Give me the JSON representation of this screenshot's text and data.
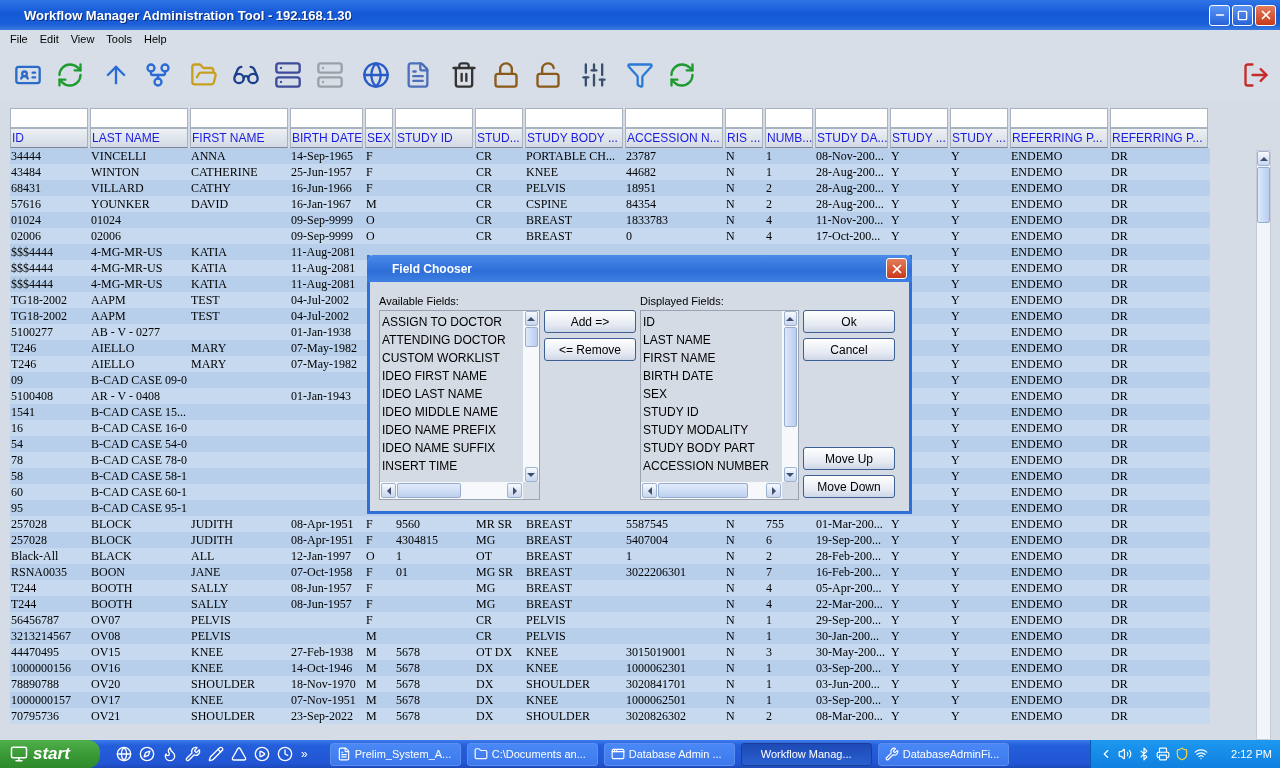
{
  "window": {
    "title": "Workflow Manager Administration Tool - 192.168.1.30"
  },
  "menu": [
    "File",
    "Edit",
    "View",
    "Tools",
    "Help"
  ],
  "toolbar": {
    "groups": [
      [
        {
          "kind": "id-card",
          "disabled": false
        },
        {
          "kind": "refresh",
          "disabled": false
        }
      ],
      [
        {
          "kind": "arrow-up",
          "disabled": false
        },
        {
          "kind": "fork",
          "disabled": false
        }
      ],
      [
        {
          "kind": "folder",
          "disabled": false
        },
        {
          "kind": "glasses",
          "disabled": false
        },
        {
          "kind": "server",
          "disabled": false
        },
        {
          "kind": "server",
          "disabled": true
        }
      ],
      [
        {
          "kind": "globe",
          "disabled": false
        },
        {
          "kind": "document",
          "disabled": false
        }
      ],
      [
        {
          "kind": "trash",
          "disabled": false
        },
        {
          "kind": "lock",
          "disabled": false
        },
        {
          "kind": "unlock",
          "disabled": false
        }
      ],
      [
        {
          "kind": "sliders",
          "disabled": false
        }
      ],
      [
        {
          "kind": "filter",
          "disabled": false
        },
        {
          "kind": "refresh",
          "disabled": false
        }
      ]
    ],
    "exit": {
      "kind": "exit",
      "disabled": false
    }
  },
  "table": {
    "columns": [
      "ID",
      "LAST NAME",
      "FIRST NAME",
      "BIRTH DATE",
      "SEX",
      "STUDY ID",
      "STUD...",
      "STUDY BODY ...",
      "ACCESSION N...",
      "RIS ...",
      "NUMB...",
      "STUDY DA...",
      "STUDY ...",
      "STUDY ...",
      "REFERRING P...",
      "REFERRING P..."
    ],
    "rows": [
      [
        "34444",
        "VINCELLI",
        "ANNA",
        "14-Sep-1965",
        "F",
        "",
        "CR",
        "PORTABLE CH...",
        "23787",
        "N",
        "1",
        "08-Nov-200...",
        "Y",
        "Y",
        "ENDEMO",
        "DR"
      ],
      [
        "43484",
        "WINTON",
        "CATHERINE",
        "25-Jun-1957",
        "F",
        "",
        "CR",
        "KNEE",
        "44682",
        "N",
        "1",
        "28-Aug-200...",
        "Y",
        "Y",
        "ENDEMO",
        "DR"
      ],
      [
        "68431",
        "VILLARD",
        "CATHY",
        "16-Jun-1966",
        "F",
        "",
        "CR",
        "PELVIS",
        "18951",
        "N",
        "2",
        "28-Aug-200...",
        "Y",
        "Y",
        "ENDEMO",
        "DR"
      ],
      [
        "57616",
        "YOUNKER",
        "DAVID",
        "16-Jan-1967",
        "M",
        "",
        "CR",
        "CSPINE",
        "84354",
        "N",
        "2",
        "28-Aug-200...",
        "Y",
        "Y",
        "ENDEMO",
        "DR"
      ],
      [
        "01024",
        "01024",
        "",
        "09-Sep-9999",
        "O",
        "",
        "CR",
        "BREAST",
        "1833783",
        "N",
        "4",
        "11-Nov-200...",
        "Y",
        "Y",
        "ENDEMO",
        "DR"
      ],
      [
        "02006",
        "02006",
        "",
        "09-Sep-9999",
        "O",
        "",
        "CR",
        "BREAST",
        "0",
        "N",
        "4",
        "17-Oct-200...",
        "Y",
        "Y",
        "ENDEMO",
        "DR"
      ],
      [
        "$$$4444",
        "4-MG-MR-US",
        "KATIA",
        "11-Aug-2081",
        "",
        "",
        "",
        "",
        "",
        "",
        "",
        "",
        "",
        "Y",
        "ENDEMO",
        "DR"
      ],
      [
        "$$$4444",
        "4-MG-MR-US",
        "KATIA",
        "11-Aug-2081",
        "",
        "",
        "",
        "",
        "",
        "",
        "",
        "",
        "",
        "Y",
        "ENDEMO",
        "DR"
      ],
      [
        "$$$4444",
        "4-MG-MR-US",
        "KATIA",
        "11-Aug-2081",
        "",
        "",
        "",
        "",
        "",
        "",
        "",
        "",
        "",
        "Y",
        "ENDEMO",
        "DR"
      ],
      [
        "TG18-2002",
        "AAPM",
        "TEST",
        "04-Jul-2002",
        "",
        "",
        "",
        "",
        "",
        "",
        "",
        "",
        "",
        "Y",
        "ENDEMO",
        "DR"
      ],
      [
        "TG18-2002",
        "AAPM",
        "TEST",
        "04-Jul-2002",
        "",
        "",
        "",
        "",
        "",
        "",
        "",
        "",
        "",
        "Y",
        "ENDEMO",
        "DR"
      ],
      [
        "5100277",
        "AB - V - 0277",
        "",
        "01-Jan-1938",
        "",
        "",
        "",
        "",
        "",
        "",
        "",
        "",
        "",
        "Y",
        "ENDEMO",
        "DR"
      ],
      [
        "T246",
        "AIELLO",
        "MARY",
        "07-May-1982",
        "",
        "",
        "",
        "",
        "",
        "",
        "",
        "",
        "",
        "Y",
        "ENDEMO",
        "DR"
      ],
      [
        "T246",
        "AIELLO",
        "MARY",
        "07-May-1982",
        "",
        "",
        "",
        "",
        "",
        "",
        "",
        "",
        "",
        "Y",
        "ENDEMO",
        "DR"
      ],
      [
        "09",
        "B-CAD CASE 09-0",
        "",
        "",
        "",
        "",
        "",
        "",
        "",
        "",
        "",
        "",
        "",
        "Y",
        "ENDEMO",
        "DR"
      ],
      [
        "5100408",
        "AR - V - 0408",
        "",
        "01-Jan-1943",
        "",
        "",
        "",
        "",
        "",
        "",
        "",
        "",
        "",
        "Y",
        "ENDEMO",
        "DR"
      ],
      [
        "1541",
        "B-CAD CASE 15...",
        "",
        "",
        "",
        "",
        "",
        "",
        "",
        "",
        "",
        "",
        "",
        "Y",
        "ENDEMO",
        "DR"
      ],
      [
        "16",
        "B-CAD CASE 16-0",
        "",
        "",
        "",
        "",
        "",
        "",
        "",
        "",
        "",
        "",
        "",
        "Y",
        "ENDEMO",
        "DR"
      ],
      [
        "54",
        "B-CAD CASE 54-0",
        "",
        "",
        "",
        "",
        "",
        "",
        "",
        "",
        "",
        "",
        "",
        "Y",
        "ENDEMO",
        "DR"
      ],
      [
        "78",
        "B-CAD CASE 78-0",
        "",
        "",
        "",
        "",
        "",
        "",
        "",
        "",
        "",
        "",
        "",
        "Y",
        "ENDEMO",
        "DR"
      ],
      [
        "58",
        "B-CAD CASE 58-1",
        "",
        "",
        "",
        "",
        "",
        "",
        "",
        "",
        "",
        "",
        "",
        "Y",
        "ENDEMO",
        "DR"
      ],
      [
        "60",
        "B-CAD CASE 60-1",
        "",
        "",
        "",
        "",
        "",
        "",
        "",
        "",
        "",
        "",
        "",
        "Y",
        "ENDEMO",
        "DR"
      ],
      [
        "95",
        "B-CAD CASE 95-1",
        "",
        "",
        "",
        "",
        "",
        "",
        "",
        "",
        "",
        "",
        "",
        "Y",
        "ENDEMO",
        "DR"
      ],
      [
        "257028",
        "BLOCK",
        "JUDITH",
        "08-Apr-1951",
        "F",
        "9560",
        "MR SR",
        "BREAST",
        "5587545",
        "N",
        "755",
        "01-Mar-200...",
        "Y",
        "Y",
        "ENDEMO",
        "DR"
      ],
      [
        "257028",
        "BLOCK",
        "JUDITH",
        "08-Apr-1951",
        "F",
        "4304815",
        "MG",
        "BREAST",
        "5407004",
        "N",
        "6",
        "19-Sep-200...",
        "Y",
        "Y",
        "ENDEMO",
        "DR"
      ],
      [
        "Black-All",
        "BLACK",
        "ALL",
        "12-Jan-1997",
        "O",
        "1",
        "OT",
        "BREAST",
        "1",
        "N",
        "2",
        "28-Feb-200...",
        "Y",
        "Y",
        "ENDEMO",
        "DR"
      ],
      [
        "RSNA0035",
        "BOON",
        "JANE",
        "07-Oct-1958",
        "F",
        "01",
        "MG SR",
        "BREAST",
        "3022206301",
        "N",
        "7",
        "16-Feb-200...",
        "Y",
        "Y",
        "ENDEMO",
        "DR"
      ],
      [
        "T244",
        "BOOTH",
        "SALLY",
        "08-Jun-1957",
        "F",
        "",
        "MG",
        "BREAST",
        "",
        "N",
        "4",
        "05-Apr-200...",
        "Y",
        "Y",
        "ENDEMO",
        "DR"
      ],
      [
        "T244",
        "BOOTH",
        "SALLY",
        "08-Jun-1957",
        "F",
        "",
        "MG",
        "BREAST",
        "",
        "N",
        "4",
        "22-Mar-200...",
        "Y",
        "Y",
        "ENDEMO",
        "DR"
      ],
      [
        "56456787",
        "OV07",
        "PELVIS",
        "",
        "F",
        "",
        "CR",
        "PELVIS",
        "",
        "N",
        "1",
        "29-Sep-200...",
        "Y",
        "Y",
        "ENDEMO",
        "DR"
      ],
      [
        "3213214567",
        "OV08",
        "PELVIS",
        "",
        "M",
        "",
        "CR",
        "PELVIS",
        "",
        "N",
        "1",
        "30-Jan-200...",
        "Y",
        "Y",
        "ENDEMO",
        "DR"
      ],
      [
        "44470495",
        "OV15",
        "KNEE",
        "27-Feb-1938",
        "M",
        "5678",
        "OT DX",
        "KNEE",
        "3015019001",
        "N",
        "3",
        "30-May-200...",
        "Y",
        "Y",
        "ENDEMO",
        "DR"
      ],
      [
        "1000000156",
        "OV16",
        "KNEE",
        "14-Oct-1946",
        "M",
        "5678",
        "DX",
        "KNEE",
        "1000062301",
        "N",
        "1",
        "03-Sep-200...",
        "Y",
        "Y",
        "ENDEMO",
        "DR"
      ],
      [
        "78890788",
        "OV20",
        "SHOULDER",
        "18-Nov-1970",
        "M",
        "5678",
        "DX",
        "SHOULDER",
        "3020841701",
        "N",
        "1",
        "03-Jun-200...",
        "Y",
        "Y",
        "ENDEMO",
        "DR"
      ],
      [
        "1000000157",
        "OV17",
        "KNEE",
        "07-Nov-1951",
        "M",
        "5678",
        "DX",
        "KNEE",
        "1000062501",
        "N",
        "1",
        "03-Sep-200...",
        "Y",
        "Y",
        "ENDEMO",
        "DR"
      ],
      [
        "70795736",
        "OV21",
        "SHOULDER",
        "23-Sep-2022",
        "M",
        "5678",
        "DX",
        "SHOULDER",
        "3020826302",
        "N",
        "2",
        "08-Mar-200...",
        "Y",
        "Y",
        "ENDEMO",
        "DR"
      ]
    ]
  },
  "dialog": {
    "title": "Field Chooser",
    "available_label": "Available Fields:",
    "available": [
      "ASSIGN TO DOCTOR",
      "ATTENDING DOCTOR",
      "CUSTOM WORKLIST",
      "IDEO FIRST NAME",
      "IDEO LAST NAME",
      "IDEO MIDDLE NAME",
      "IDEO NAME PREFIX",
      "IDEO NAME SUFFIX",
      "INSERT TIME"
    ],
    "add": "Add =>",
    "remove": "<= Remove",
    "displayed_label": "Displayed Fields:",
    "displayed": [
      "ID",
      "LAST NAME",
      "FIRST NAME",
      "BIRTH DATE",
      "SEX",
      "STUDY ID",
      "STUDY MODALITY",
      "STUDY BODY PART",
      "ACCESSION NUMBER"
    ],
    "ok": "Ok",
    "cancel": "Cancel",
    "move_up": "Move Up",
    "move_down": "Move Down"
  },
  "taskbar": {
    "start": "start",
    "quick_launch": [
      {
        "kind": "globe"
      },
      {
        "kind": "compass"
      },
      {
        "kind": "flame"
      },
      {
        "kind": "tool"
      },
      {
        "kind": "pencil"
      },
      {
        "kind": "triangle"
      },
      {
        "kind": "play"
      },
      {
        "kind": "clock"
      }
    ],
    "more": "»",
    "tasks": [
      {
        "label": "Prelim_System_A...",
        "kind": "document",
        "selected": false
      },
      {
        "label": "C:\\Documents an...",
        "kind": "folder",
        "selected": false
      },
      {
        "label": "Database Admin ...",
        "kind": "window",
        "selected": false
      },
      {
        "label": "Workflow Manag...",
        "kind": "plain",
        "selected": true
      },
      {
        "label": "DatabaseAdminFi...",
        "kind": "tool",
        "selected": false
      }
    ],
    "clock": "2:12 PM"
  }
}
